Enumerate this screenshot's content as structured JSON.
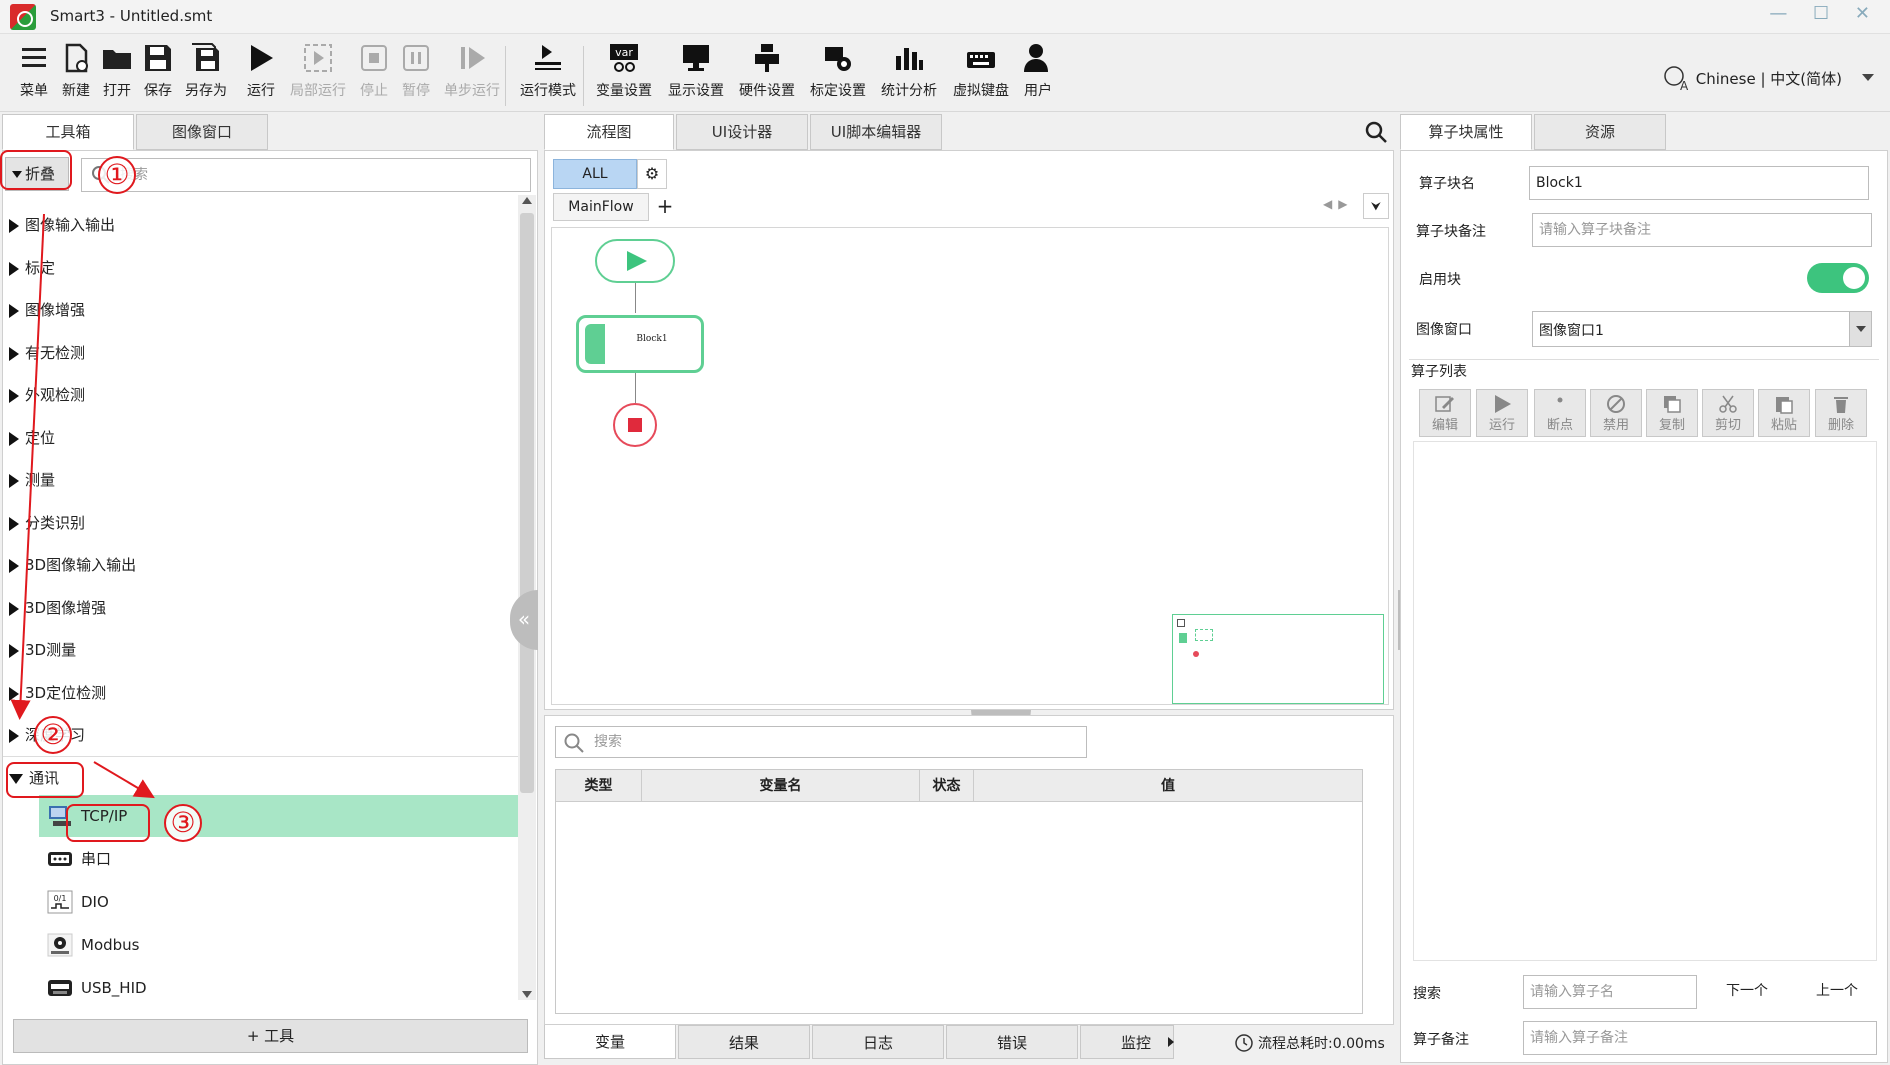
{
  "window": {
    "title": "Smart3 - Untitled.smt",
    "controls": "— ☐ ✕"
  },
  "toolbar": {
    "items": [
      {
        "label": "菜单",
        "icon": "menu-icon",
        "enabled": true
      },
      {
        "label": "新建",
        "icon": "new-file-icon",
        "enabled": true
      },
      {
        "label": "打开",
        "icon": "folder-open-icon",
        "enabled": true
      },
      {
        "label": "保存",
        "icon": "save-icon",
        "enabled": true
      },
      {
        "label": "另存为",
        "icon": "save-as-icon",
        "enabled": true
      },
      {
        "label": "运行",
        "icon": "play-icon",
        "enabled": true
      },
      {
        "label": "局部运行",
        "icon": "partial-run-icon",
        "enabled": false
      },
      {
        "label": "停止",
        "icon": "stop-icon",
        "enabled": false
      },
      {
        "label": "暂停",
        "icon": "pause-icon",
        "enabled": false
      },
      {
        "label": "单步运行",
        "icon": "step-run-icon",
        "enabled": false
      },
      {
        "label": "运行模式",
        "icon": "run-mode-icon",
        "enabled": true
      },
      {
        "label": "变量设置",
        "icon": "variable-icon",
        "enabled": true
      },
      {
        "label": "显示设置",
        "icon": "display-icon",
        "enabled": true
      },
      {
        "label": "硬件设置",
        "icon": "hardware-icon",
        "enabled": true
      },
      {
        "label": "标定设置",
        "icon": "calibration-icon",
        "enabled": true
      },
      {
        "label": "统计分析",
        "icon": "statistics-icon",
        "enabled": true
      },
      {
        "label": "虚拟键盘",
        "icon": "keyboard-icon",
        "enabled": true
      },
      {
        "label": "用户",
        "icon": "user-icon",
        "enabled": true
      }
    ],
    "language": "Chinese | 中文(简体)"
  },
  "left": {
    "tabs": [
      "工具箱",
      "图像窗口"
    ],
    "collapse_label": "折叠",
    "search_placeholder": "搜索",
    "categories": [
      "图像输入输出",
      "标定",
      "图像增强",
      "有无检测",
      "外观检测",
      "定位",
      "测量",
      "分类识别",
      "3D图像输入输出",
      "3D图像增强",
      "3D测量",
      "3D定位检测",
      "深度学习",
      "通讯"
    ],
    "tools": [
      "TCP/IP",
      "串口",
      "DIO",
      "Modbus",
      "USB_HID"
    ],
    "add_tool": "+ 工具"
  },
  "annotations": {
    "one": "①",
    "two": "②",
    "three": "③"
  },
  "center": {
    "tabs": [
      "流程图",
      "UI设计器",
      "UI脚本编辑器"
    ],
    "filter_all": "ALL",
    "flow_tab": "MainFlow",
    "block_name": "Block1",
    "var_search_placeholder": "搜索",
    "var_headers": [
      "类型",
      "变量名",
      "状态",
      "值"
    ],
    "bottom_tabs": [
      "变量",
      "结果",
      "日志",
      "错误",
      "监控"
    ],
    "total_time": "流程总耗时:0.00ms"
  },
  "right": {
    "tabs": [
      "算子块属性",
      "资源"
    ],
    "block_name_label": "算子块名",
    "block_name_value": "Block1",
    "block_note_label": "算子块备注",
    "block_note_placeholder": "请输入算子块备注",
    "enable_label": "启用块",
    "image_window_label": "图像窗口",
    "image_window_value": "图像窗口1",
    "operator_list_label": "算子列表",
    "op_buttons": [
      "编辑",
      "运行",
      "断点",
      "禁用",
      "复制",
      "剪切",
      "粘贴",
      "删除"
    ],
    "search_label": "搜索",
    "search_placeholder": "请输入算子名",
    "next": "下一个",
    "prev": "上一个",
    "op_note_label": "算子备注",
    "op_note_placeholder": "请输入算子备注"
  }
}
